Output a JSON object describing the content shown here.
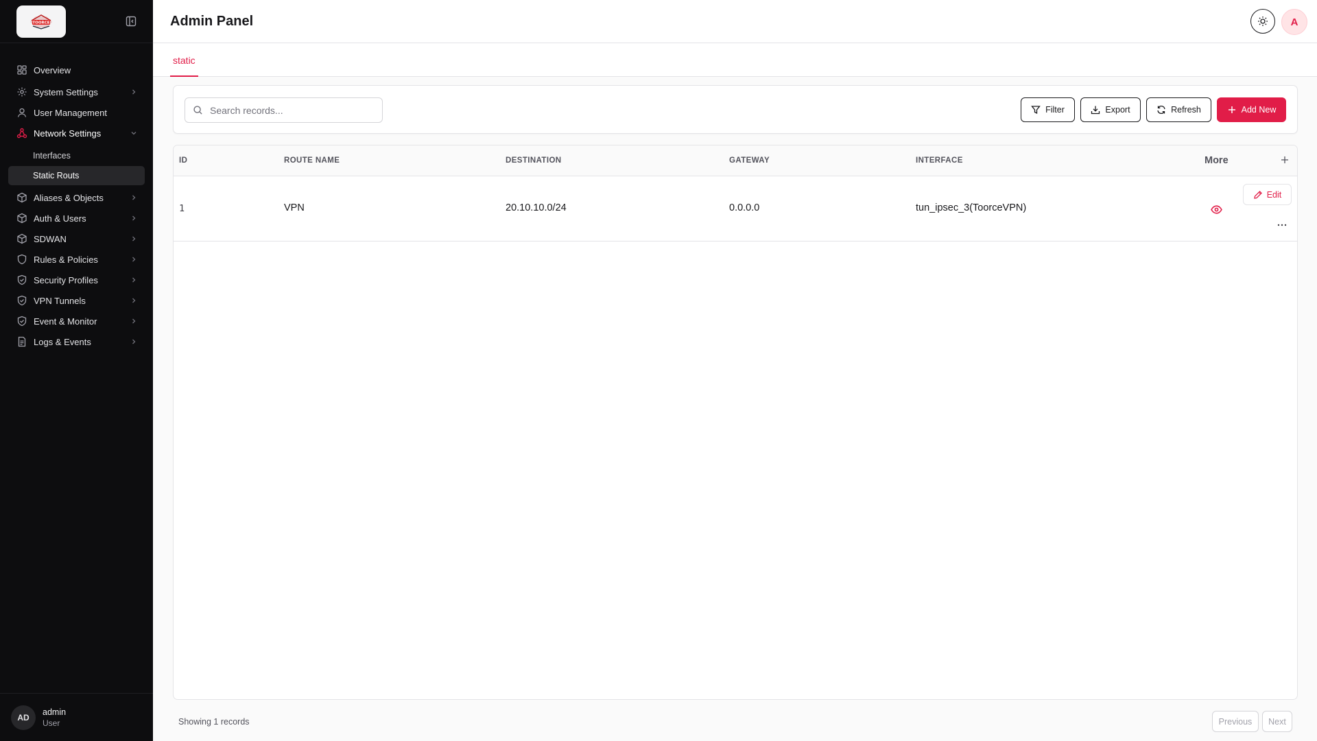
{
  "brand": {
    "logo_text": "TOORCE",
    "accent": "#e11d48"
  },
  "header": {
    "title": "Admin Panel",
    "avatar_initial": "A"
  },
  "sidebar": {
    "items": [
      {
        "label": "Overview"
      },
      {
        "label": "System Settings"
      },
      {
        "label": "User Management"
      },
      {
        "label": "Network Settings",
        "children": [
          {
            "label": "Interfaces"
          },
          {
            "label": "Static Routs"
          }
        ]
      },
      {
        "label": "Aliases & Objects"
      },
      {
        "label": "Auth & Users"
      },
      {
        "label": "SDWAN"
      },
      {
        "label": "Rules & Policies"
      },
      {
        "label": "Security Profiles"
      },
      {
        "label": "VPN Tunnels"
      },
      {
        "label": "Event & Monitor"
      },
      {
        "label": "Logs & Events"
      }
    ],
    "user": {
      "initials": "AD",
      "name": "admin",
      "role": "User"
    }
  },
  "tabs": [
    {
      "label": "static",
      "active": true
    }
  ],
  "toolbar": {
    "search_placeholder": "Search records...",
    "filter_label": "Filter",
    "export_label": "Export",
    "refresh_label": "Refresh",
    "add_label": "Add New"
  },
  "table": {
    "columns": [
      "ID",
      "ROUTE NAME",
      "DESTINATION",
      "GATEWAY",
      "INTERFACE"
    ],
    "more_label": "More",
    "rows": [
      {
        "id": "1",
        "route_name": "VPN",
        "destination": "20.10.10.0/24",
        "gateway": "0.0.0.0",
        "interface": "tun_ipsec_3(ToorceVPN)",
        "edit_label": "Edit"
      }
    ]
  },
  "footer": {
    "showing": "Showing 1 records",
    "previous_label": "Previous",
    "next_label": "Next"
  }
}
